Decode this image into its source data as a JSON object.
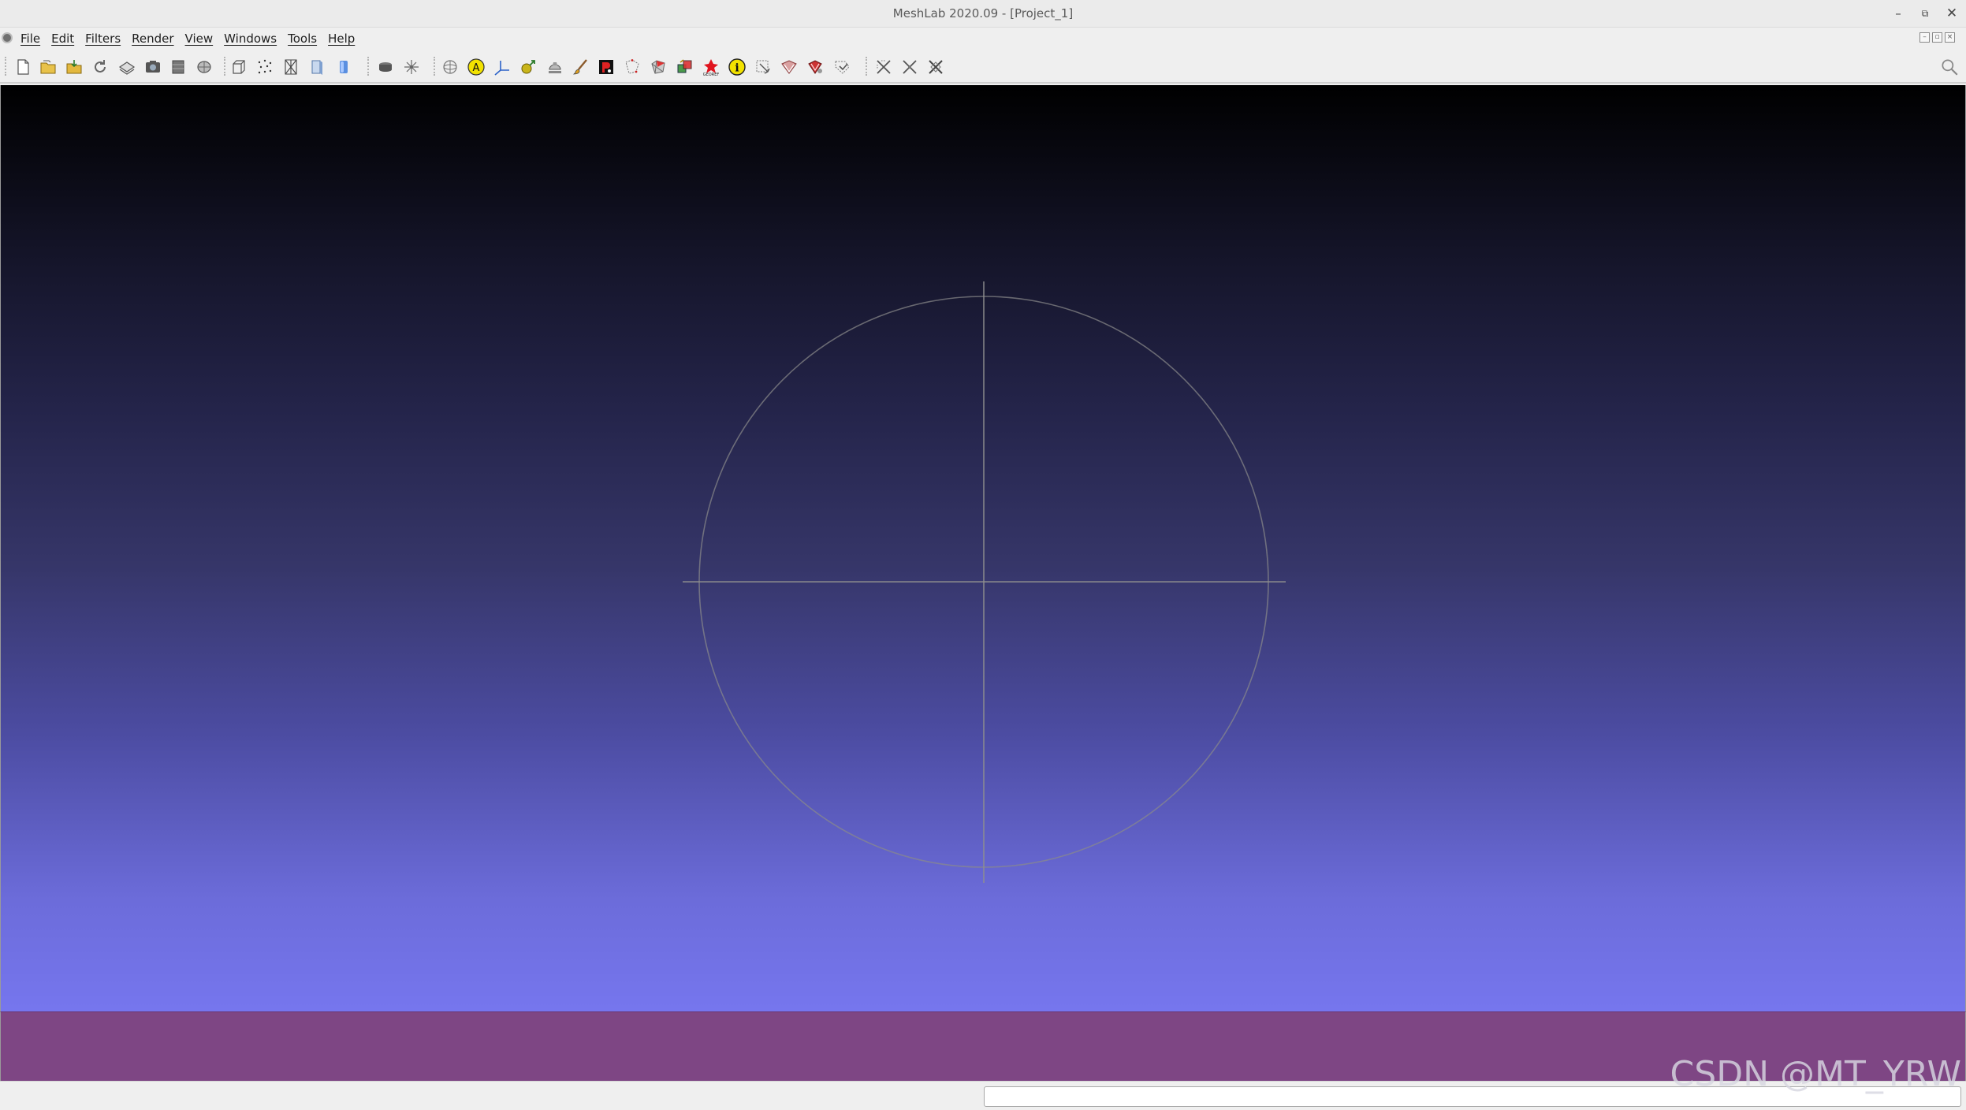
{
  "window": {
    "title": "MeshLab 2020.09 - [Project_1]",
    "minimize_glyph": "–",
    "maximize_glyph": "⧉",
    "close_glyph": "✕"
  },
  "menubar": {
    "items": [
      {
        "label": "File"
      },
      {
        "label": "Edit"
      },
      {
        "label": "Filters"
      },
      {
        "label": "Render"
      },
      {
        "label": "View"
      },
      {
        "label": "Windows"
      },
      {
        "label": "Tools"
      },
      {
        "label": "Help"
      }
    ]
  },
  "toolbar": {
    "buttons": [
      {
        "name": "new-project-icon"
      },
      {
        "name": "open-project-icon"
      },
      {
        "name": "import-mesh-icon"
      },
      {
        "name": "reload-icon"
      },
      {
        "name": "export-mesh-icon"
      },
      {
        "name": "snapshot-icon"
      },
      {
        "name": "layer-icon"
      },
      {
        "name": "raster-icon"
      },
      {
        "name": "bbox-icon"
      },
      {
        "name": "points-icon"
      },
      {
        "name": "wireframe-icon"
      },
      {
        "name": "flat-icon"
      },
      {
        "name": "smooth-icon"
      },
      {
        "name": "layers-dialog-icon"
      },
      {
        "name": "decorate-icon"
      },
      {
        "name": "trackball-icon"
      },
      {
        "name": "annotation-icon"
      },
      {
        "name": "axis-icon"
      },
      {
        "name": "manipulator-icon"
      },
      {
        "name": "texture-icon"
      },
      {
        "name": "paint-brush-icon"
      },
      {
        "name": "pick-points-icon"
      },
      {
        "name": "select-vertices-icon"
      },
      {
        "name": "select-faces-icon"
      },
      {
        "name": "align-icon"
      },
      {
        "name": "georef-icon"
      },
      {
        "name": "info-icon"
      },
      {
        "name": "select-connected-icon"
      },
      {
        "name": "select-z-painting-icon"
      },
      {
        "name": "select-faces-painted-icon"
      },
      {
        "name": "measure-icon"
      },
      {
        "name": "delete-selected-icon"
      },
      {
        "name": "delete-vertices-icon"
      },
      {
        "name": "delete-faces-icon"
      }
    ]
  },
  "viewport": {
    "background_top": "#000000",
    "background_bottom": "#7676ee",
    "trackball_color": "#8a8a8a"
  },
  "log_panel": {
    "color": "#7e4684"
  },
  "watermark": {
    "text": "CSDN @MT_YRW"
  }
}
